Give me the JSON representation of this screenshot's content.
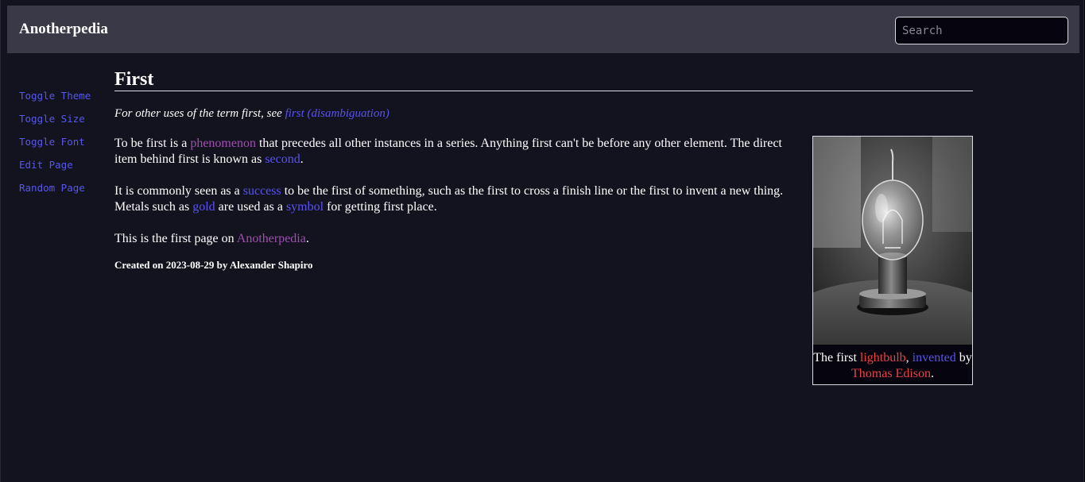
{
  "header": {
    "site_title": "Anotherpedia",
    "search_placeholder": "Search"
  },
  "sidebar": {
    "items": [
      {
        "label": "Toggle Theme"
      },
      {
        "label": "Toggle Size"
      },
      {
        "label": "Toggle Font"
      },
      {
        "label": "Edit Page"
      },
      {
        "label": "Random Page"
      }
    ]
  },
  "article": {
    "title": "First",
    "hatnote": {
      "prefix": "For other uses of the term first, see ",
      "link": "first (disambiguation)"
    },
    "p1": {
      "t1": "To be first is a ",
      "link1": "phenomenon",
      "t2": " that precedes all other instances in a series. Anything first can't be before any other element. The direct item behind first is known as ",
      "link2": "second",
      "t3": "."
    },
    "p2": {
      "t1": "It is commonly seen as a ",
      "link1": "success",
      "t2": " to be the first of something, such as the first to cross a finish line or the first to invent a new thing. Metals such as ",
      "link2": "gold",
      "t3": " are used as a ",
      "link3": "symbol",
      "t4": " for getting first place."
    },
    "p3": {
      "t1": "This is the first page on ",
      "link1": "Anotherpedia",
      "t2": "."
    },
    "created": "Created on 2023-08-29 by Alexander Shapiro"
  },
  "figure": {
    "image_icon": "lightbulb-photo",
    "caption": {
      "t1": "The first ",
      "link1": "lightbulb",
      "t2": ", ",
      "link2": "invented",
      "t3": " by ",
      "link3": "Thomas Edison",
      "t4": "."
    }
  },
  "colors": {
    "background": "#13121f",
    "header": "#3a3947",
    "link": "#5a52ef",
    "visited_link": "#a04fb0",
    "missing_link": "#e84343"
  }
}
